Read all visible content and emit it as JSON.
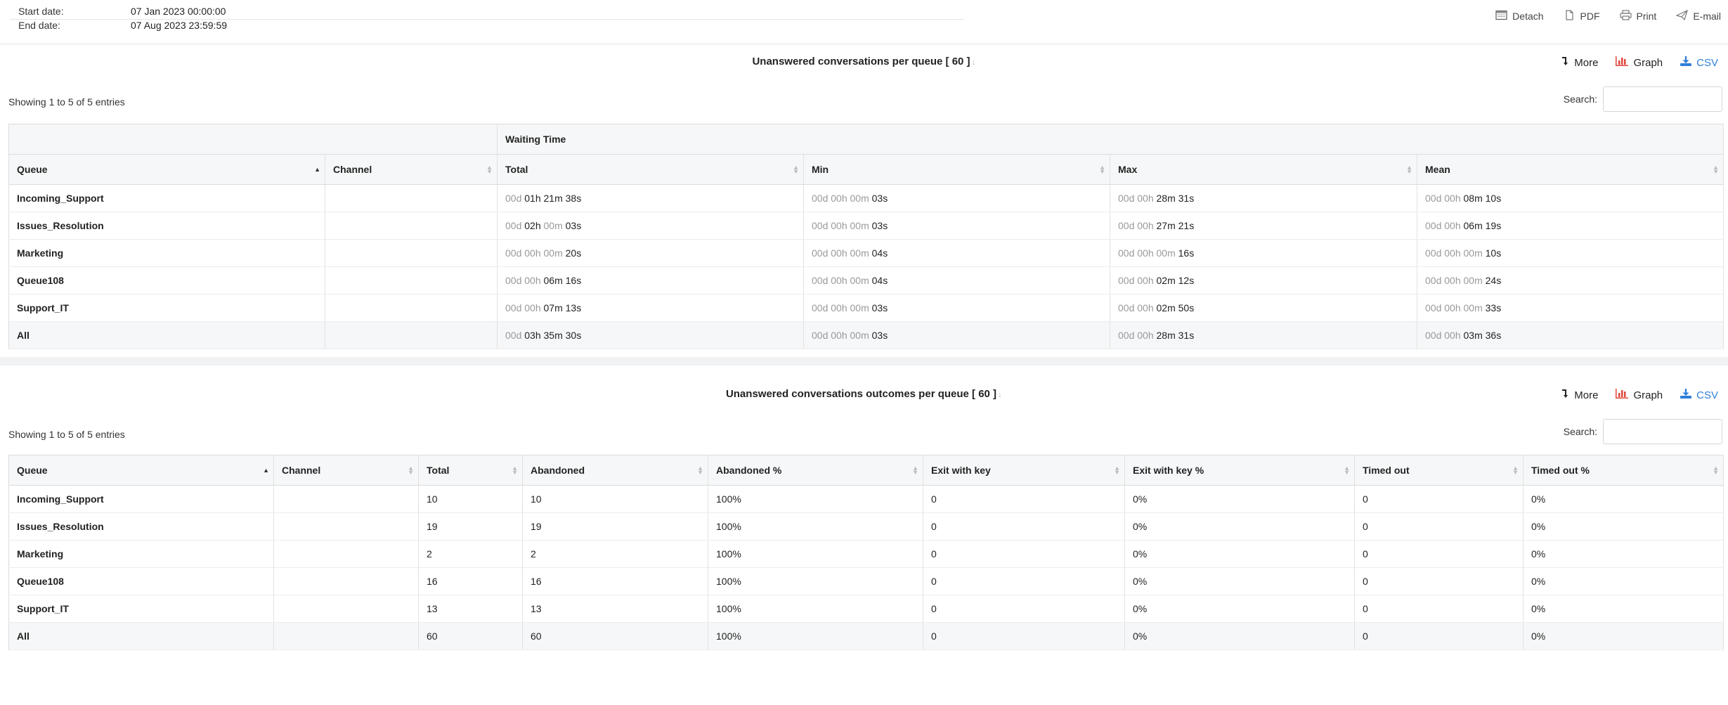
{
  "header": {
    "start_label": "Start date:",
    "start_value": "07 Jan 2023 00:00:00",
    "end_label": "End date:",
    "end_value": "07 Aug 2023 23:59:59",
    "actions": {
      "detach": "Detach",
      "pdf": "PDF",
      "print": "Print",
      "email": "E-mail"
    }
  },
  "section1": {
    "title": "Unanswered conversations per queue [ 60 ]",
    "more": "More",
    "graph": "Graph",
    "csv": "CSV",
    "showing": "Showing 1 to 5 of 5 entries",
    "search_label": "Search:",
    "group_header": "Waiting Time",
    "columns": [
      "Queue",
      "Channel",
      "Total",
      "Min",
      "Max",
      "Mean"
    ],
    "rows": [
      {
        "queue": "Incoming_Support",
        "channel": "",
        "total": {
          "dim": "00d ",
          "val": "01h 21m 38s"
        },
        "min": {
          "dim": "00d 00h 00m ",
          "val": "03s"
        },
        "max": {
          "dim": "00d 00h ",
          "val": "28m 31s"
        },
        "mean": {
          "dim": "00d 00h ",
          "val": "08m 10s"
        }
      },
      {
        "queue": "Issues_Resolution",
        "channel": "",
        "total": {
          "dim": "00d ",
          "val": "02h",
          "dim2": " 00m ",
          "val2": "03s"
        },
        "min": {
          "dim": "00d 00h 00m ",
          "val": "03s"
        },
        "max": {
          "dim": "00d 00h ",
          "val": "27m 21s"
        },
        "mean": {
          "dim": "00d 00h ",
          "val": "06m 19s"
        }
      },
      {
        "queue": "Marketing",
        "channel": "",
        "total": {
          "dim": "00d 00h 00m ",
          "val": "20s"
        },
        "min": {
          "dim": "00d 00h 00m ",
          "val": "04s"
        },
        "max": {
          "dim": "00d 00h 00m ",
          "val": "16s"
        },
        "mean": {
          "dim": "00d 00h 00m ",
          "val": "10s"
        }
      },
      {
        "queue": "Queue108",
        "channel": "",
        "total": {
          "dim": "00d 00h ",
          "val": "06m 16s"
        },
        "min": {
          "dim": "00d 00h 00m ",
          "val": "04s"
        },
        "max": {
          "dim": "00d 00h ",
          "val": "02m 12s"
        },
        "mean": {
          "dim": "00d 00h 00m ",
          "val": "24s"
        }
      },
      {
        "queue": "Support_IT",
        "channel": "",
        "total": {
          "dim": "00d 00h ",
          "val": "07m 13s"
        },
        "min": {
          "dim": "00d 00h 00m ",
          "val": "03s"
        },
        "max": {
          "dim": "00d 00h ",
          "val": "02m 50s"
        },
        "mean": {
          "dim": "00d 00h 00m ",
          "val": "33s"
        }
      }
    ],
    "total_row": {
      "queue": "All",
      "channel": "",
      "total": {
        "dim": "00d ",
        "val": "03h 35m 30s"
      },
      "min": {
        "dim": "00d 00h 00m ",
        "val": "03s"
      },
      "max": {
        "dim": "00d 00h ",
        "val": "28m 31s"
      },
      "mean": {
        "dim": "00d 00h ",
        "val": "03m 36s"
      }
    }
  },
  "section2": {
    "title": "Unanswered conversations outcomes per queue [ 60 ]",
    "more": "More",
    "graph": "Graph",
    "csv": "CSV",
    "showing": "Showing 1 to 5 of 5 entries",
    "search_label": "Search:",
    "columns": [
      "Queue",
      "Channel",
      "Total",
      "Abandoned",
      "Abandoned %",
      "Exit with key",
      "Exit with key %",
      "Timed out",
      "Timed out %"
    ],
    "rows": [
      [
        "Incoming_Support",
        "",
        "10",
        "10",
        "100%",
        "0",
        "0%",
        "0",
        "0%"
      ],
      [
        "Issues_Resolution",
        "",
        "19",
        "19",
        "100%",
        "0",
        "0%",
        "0",
        "0%"
      ],
      [
        "Marketing",
        "",
        "2",
        "2",
        "100%",
        "0",
        "0%",
        "0",
        "0%"
      ],
      [
        "Queue108",
        "",
        "16",
        "16",
        "100%",
        "0",
        "0%",
        "0",
        "0%"
      ],
      [
        "Support_IT",
        "",
        "13",
        "13",
        "100%",
        "0",
        "0%",
        "0",
        "0%"
      ]
    ],
    "total_row": [
      "All",
      "",
      "60",
      "60",
      "100%",
      "0",
      "0%",
      "0",
      "0%"
    ]
  },
  "colors": {
    "csv_blue": "#2f7fd8",
    "graph_red": "#e0453a",
    "header_bg": "#f6f7f8"
  },
  "icons": {
    "detach": "window-icon",
    "pdf": "file-pdf-icon",
    "print": "printer-icon",
    "email": "paper-plane-icon",
    "more": "level-down-icon",
    "graph": "bar-chart-icon",
    "csv": "download-icon"
  }
}
